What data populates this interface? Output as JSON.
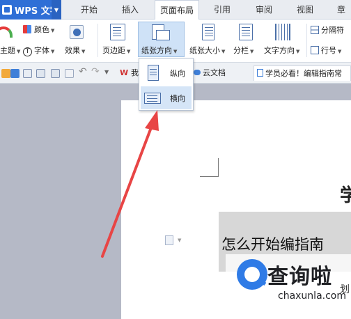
{
  "menubar": {
    "app_label": "WPS 文字",
    "tabs": [
      {
        "label": "开始",
        "active": false
      },
      {
        "label": "插入",
        "active": false
      },
      {
        "label": "页面布局",
        "active": true
      },
      {
        "label": "引用",
        "active": false
      },
      {
        "label": "审阅",
        "active": false
      },
      {
        "label": "视图",
        "active": false
      },
      {
        "label": "章",
        "active": false
      }
    ]
  },
  "ribbon": {
    "color_label": "颜色",
    "theme_label": "主题",
    "font_label": "字体",
    "effect_label": "效果",
    "margin_label": "页边距",
    "orientation_label": "纸张方向",
    "size_label": "纸张大小",
    "columns_label": "分栏",
    "text_direction_label": "文字方向",
    "separator_label": "分隔符",
    "line_number_label": "行号"
  },
  "orientation_menu": {
    "items": [
      {
        "label": "纵向",
        "highlighted": false
      },
      {
        "label": "横向",
        "highlighted": true
      }
    ]
  },
  "toolbar2": {
    "doc_tabs": [
      {
        "label": "我"
      },
      {
        "label": "云文档"
      },
      {
        "label": "学员必看！编辑指南常"
      }
    ]
  },
  "document": {
    "title_char": "学",
    "heading": "怎么开始编指南",
    "side_char": "划"
  },
  "watermark": {
    "cn": "查询啦",
    "en": "chaxunla.com"
  },
  "colors": {
    "accent": "#2f6fd6",
    "active_tab_bg": "#ffffff",
    "highlight": "#d5e5f7",
    "arrow": "#e84545"
  }
}
